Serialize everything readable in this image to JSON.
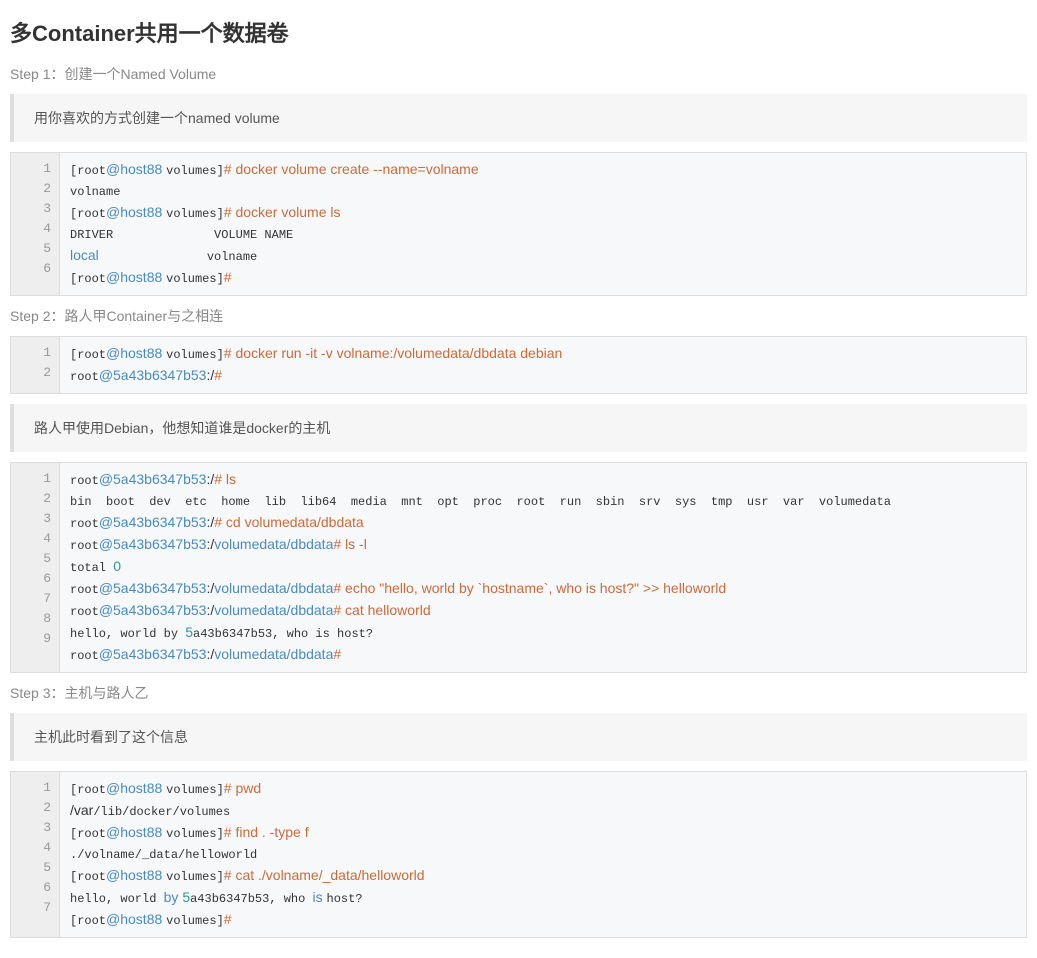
{
  "title": "多Container共用一个数据卷",
  "step1": {
    "label": "Step 1：创建一个Named Volume",
    "quote": "用你喜欢的方式创建一个named volume",
    "lines": 6,
    "l1a": "[root",
    "l1b": "@host88 ",
    "l1c": "volumes]",
    "l1d": "# docker volume create --name=volname",
    "l2": "volname",
    "l3a": "[root",
    "l3b": "@host88 ",
    "l3c": "volumes]",
    "l3d": "# docker volume ls",
    "l4": "DRIVER              VOLUME NAME",
    "l5a": "local",
    "l5b": "               volname",
    "l6a": "[root",
    "l6b": "@host88 ",
    "l6c": "volumes]",
    "l6d": "#"
  },
  "step2": {
    "label": "Step 2：路人甲Container与之相连",
    "linesA": 2,
    "a1a": "[root",
    "a1b": "@host88 ",
    "a1c": "volumes]",
    "a1d": "# docker run -it -v volname:/volumedata/dbdata debian",
    "a2a": "root",
    "a2b": "@5a43b6347b53",
    "a2c": ":/",
    "a2d": "#",
    "quote": "路人甲使用Debian，他想知道谁是docker的主机",
    "linesB": 9,
    "b1a": "root",
    "b1b": "@5a43b6347b53",
    "b1c": ":/",
    "b1d": "# ls",
    "b2": "bin  boot  dev  etc  home  lib  lib64  media  mnt  opt  proc  root  run  sbin  srv  sys  tmp  usr  var  volumedata",
    "b3a": "root",
    "b3b": "@5a43b6347b53",
    "b3c": ":/",
    "b3d": "# cd volumedata/dbdata",
    "b4a": "root",
    "b4b": "@5a43b6347b53",
    "b4c": ":/",
    "b4d": "volumedata/",
    "b4e": "dbdata",
    "b4f": "# ls -l",
    "b5a": "total ",
    "b5b": "0",
    "b6a": "root",
    "b6b": "@5a43b6347b53",
    "b6c": ":/",
    "b6d": "volumedata/",
    "b6e": "dbdata",
    "b6f": "# echo \"hello, world by `hostname`, who is host?\" >> helloworld",
    "b7a": "root",
    "b7b": "@5a43b6347b53",
    "b7c": ":/",
    "b7d": "volumedata/",
    "b7e": "dbdata",
    "b7f": "# cat helloworld",
    "b8": "hello, world by 5a43b6347b53, who is host?",
    "b8a": "hello, world by ",
    "b8b": "5",
    "b8c": "a43b6347b53, who is host?",
    "b9a": "root",
    "b9b": "@5a43b6347b53",
    "b9c": ":/",
    "b9d": "volumedata/",
    "b9e": "dbdata",
    "b9f": "#"
  },
  "step3": {
    "label": "Step 3：主机与路人乙",
    "quote": "主机此时看到了这个信息",
    "lines": 7,
    "c1a": "[root",
    "c1b": "@host88 ",
    "c1c": "volumes]",
    "c1d": "# pwd",
    "c2a": "/var",
    "c2b": "/lib/docker/volumes",
    "c3a": "[root",
    "c3b": "@host88 ",
    "c3c": "volumes]",
    "c3d": "# find . -type f",
    "c4": "./volname/_data/helloworld",
    "c5a": "[root",
    "c5b": "@host88 ",
    "c5c": "volumes]",
    "c5d": "# cat ./volname/_data/helloworld",
    "c6a": "hello, world ",
    "c6b": "by ",
    "c6c": "5",
    "c6d": "a43b6347b53, who ",
    "c6e": "is ",
    "c6f": "host?",
    "c7a": "[root",
    "c7b": "@host88 ",
    "c7c": "volumes]",
    "c7d": "#"
  }
}
